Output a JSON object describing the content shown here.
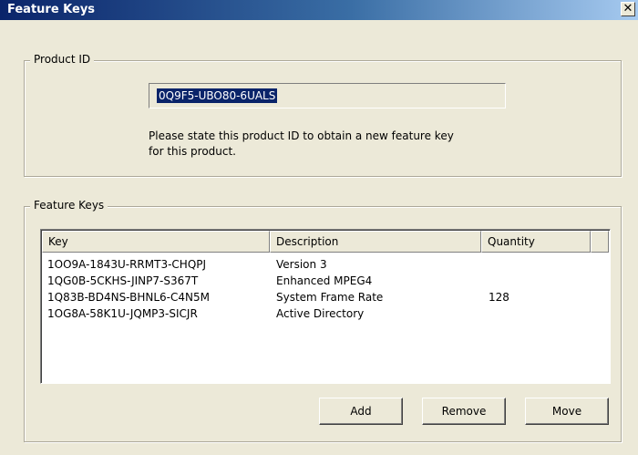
{
  "window": {
    "title": "Feature Keys",
    "close_glyph": "✕"
  },
  "product_group": {
    "label": "Product ID",
    "product_id": "0Q9F5-UBO80-6UALS",
    "hint_line1": "Please state this product ID to obtain a new feature key",
    "hint_line2": "for this product."
  },
  "keys_group": {
    "label": "Feature Keys",
    "columns": [
      "Key",
      "Description",
      "Quantity"
    ],
    "rows": [
      {
        "key": "1OO9A-1843U-RRMT3-CHQPJ",
        "description": "Version 3",
        "quantity": ""
      },
      {
        "key": "1QG0B-5CKHS-JINP7-S367T",
        "description": "Enhanced MPEG4",
        "quantity": ""
      },
      {
        "key": "1Q83B-BD4NS-BHNL6-C4N5M",
        "description": "System Frame Rate",
        "quantity": "128"
      },
      {
        "key": "1OG8A-58K1U-JQMP3-SICJR",
        "description": "Active Directory",
        "quantity": ""
      }
    ]
  },
  "buttons": {
    "add": "Add",
    "remove": "Remove",
    "move": "Move"
  }
}
